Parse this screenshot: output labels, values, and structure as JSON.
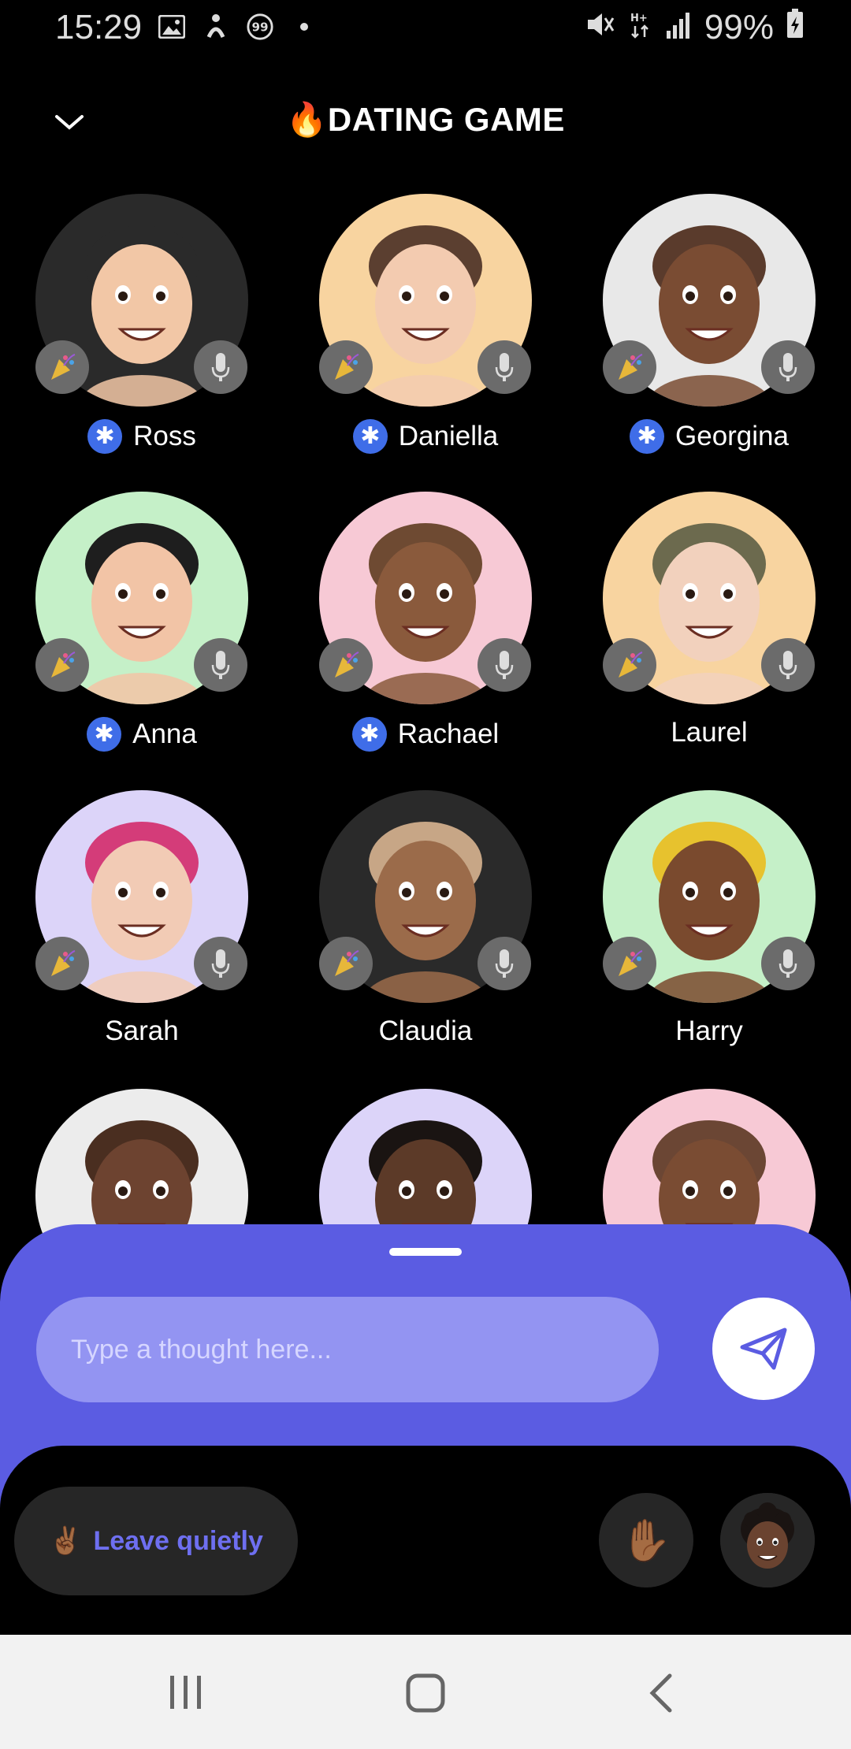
{
  "status_bar": {
    "time": "15:29",
    "battery": "99%",
    "left_icons": [
      "image-icon",
      "activity-icon",
      "badge-99-icon",
      "dot-icon"
    ],
    "right_icons": [
      "mute-icon",
      "data-icon",
      "signal-icon",
      "battery-icon"
    ]
  },
  "header": {
    "title": "🔥DATING GAME",
    "collapse_icon": "chevron-down-icon"
  },
  "people": [
    {
      "name": "Ross",
      "verified": true,
      "bg": "#2a2a2a",
      "skin": "#f2c7a6",
      "hair": "#2a2a2a"
    },
    {
      "name": "Daniella",
      "verified": true,
      "bg": "#f8d4a0",
      "skin": "#f3cbb0",
      "hair": "#5b3f30"
    },
    {
      "name": "Georgina",
      "verified": true,
      "bg": "#e8e8e8",
      "skin": "#7a4c33",
      "hair": "#5a3b2c"
    },
    {
      "name": "Anna",
      "verified": true,
      "bg": "#c5f0c8",
      "skin": "#f2c4a6",
      "hair": "#1e1e1e"
    },
    {
      "name": "Rachael",
      "verified": true,
      "bg": "#f7c9d5",
      "skin": "#8a5a3c",
      "hair": "#6e4a32"
    },
    {
      "name": "Laurel",
      "verified": false,
      "bg": "#f8d4a0",
      "skin": "#f2d1bd",
      "hair": "#6c6a4e"
    },
    {
      "name": "Sarah",
      "verified": false,
      "bg": "#dcd4f9",
      "skin": "#f2cbb5",
      "hair": "#d43c79"
    },
    {
      "name": "Claudia",
      "verified": false,
      "bg": "#2a2a2a",
      "skin": "#9b6b4a",
      "hair": "#c7a686"
    },
    {
      "name": "Harry",
      "verified": false,
      "bg": "#c5f0c8",
      "skin": "#7a4a2e",
      "hair": "#e7c22e"
    },
    {
      "name": "",
      "verified": false,
      "bg": "#ececec",
      "skin": "#6d4330",
      "hair": "#4a2e20"
    },
    {
      "name": "",
      "verified": false,
      "bg": "#dcd4f9",
      "skin": "#5c3a28",
      "hair": "#1a1412"
    },
    {
      "name": "",
      "verified": false,
      "bg": "#f7c9d5",
      "skin": "#7a4c33",
      "hair": "#6b4634"
    }
  ],
  "composer": {
    "placeholder": "Type a thought here...",
    "send_icon": "send-icon"
  },
  "actions": {
    "leave_emoji": "✌🏾",
    "leave_label": "Leave quietly",
    "raise_hand_emoji": "✋🏾"
  },
  "colors": {
    "sheet": "#5b5ce2",
    "input": "#9394f2",
    "accent": "#6e6ff0",
    "verified": "#3f6de8"
  }
}
